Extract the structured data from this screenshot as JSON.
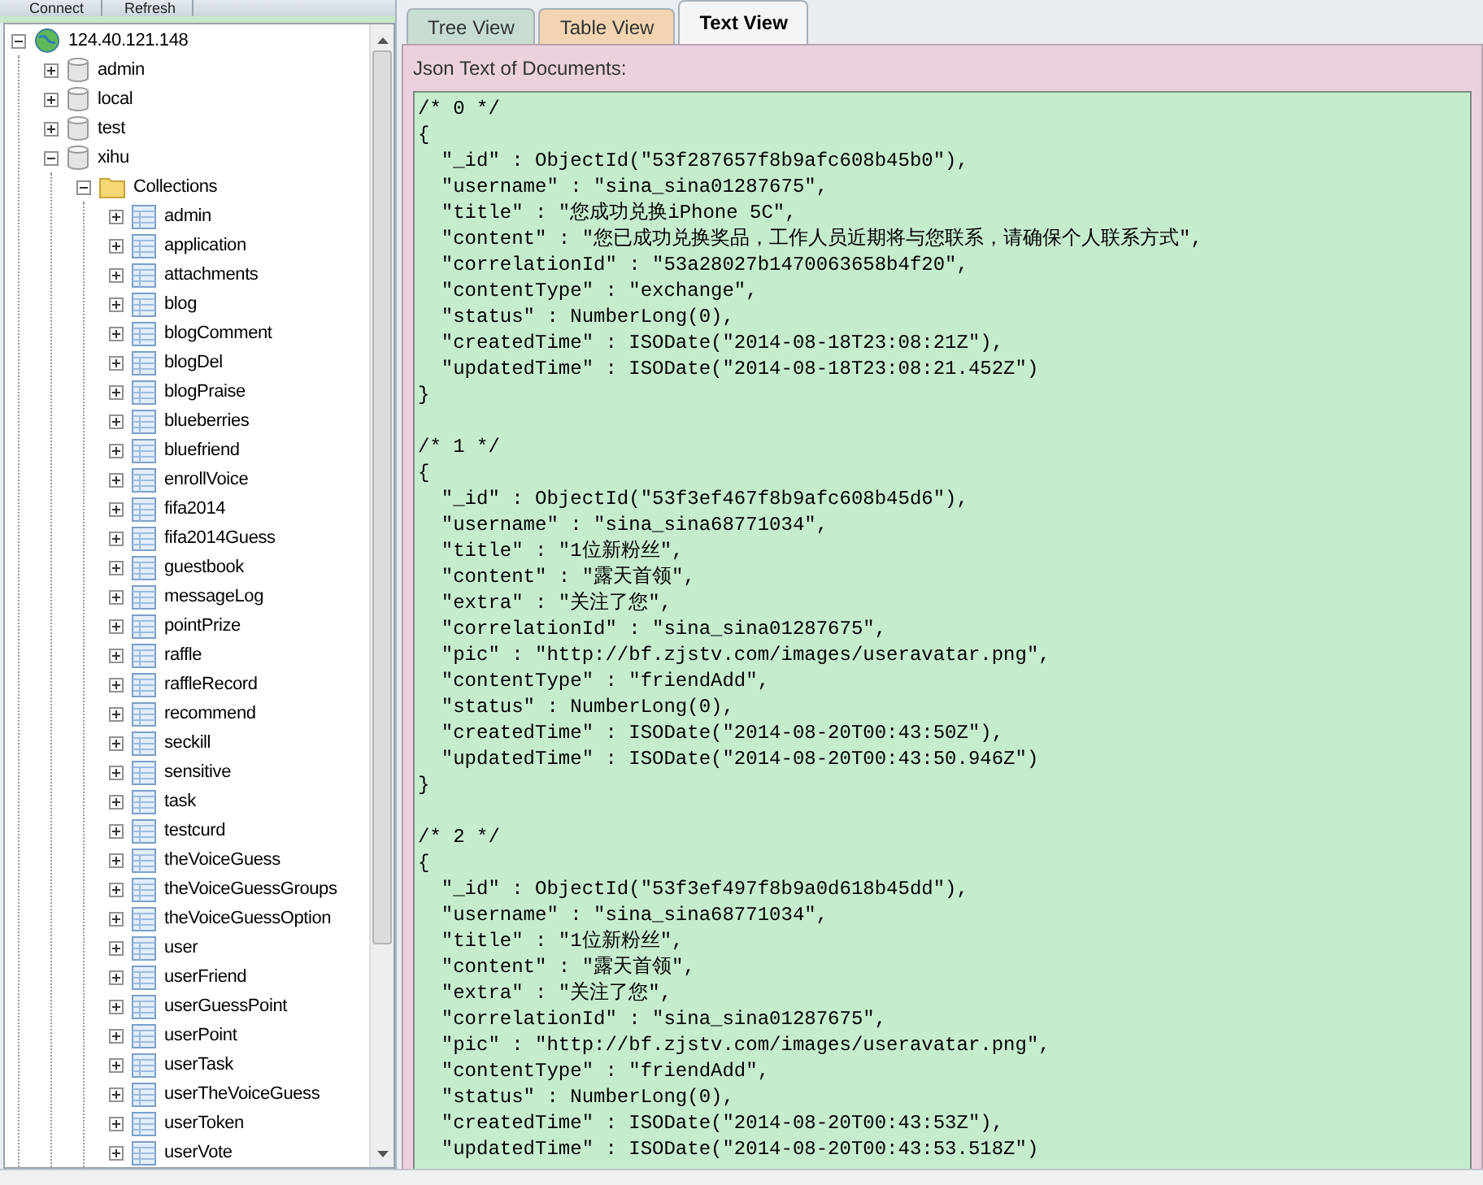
{
  "toolbar": {
    "buttons": [
      "Connect",
      "Refresh"
    ]
  },
  "tree": [
    {
      "label": "124.40.121.148",
      "kind": "server",
      "expanded": true,
      "children": [
        {
          "label": "admin",
          "kind": "database",
          "expanded": false
        },
        {
          "label": "local",
          "kind": "database",
          "expanded": false
        },
        {
          "label": "test",
          "kind": "database",
          "expanded": false
        },
        {
          "label": "xihu",
          "kind": "database",
          "expanded": true,
          "children": [
            {
              "label": "Collections",
              "kind": "folder",
              "expanded": true,
              "children": [
                {
                  "label": "admin",
                  "kind": "collection",
                  "expanded": false
                },
                {
                  "label": "application",
                  "kind": "collection",
                  "expanded": false
                },
                {
                  "label": "attachments",
                  "kind": "collection",
                  "expanded": false
                },
                {
                  "label": "blog",
                  "kind": "collection",
                  "expanded": false
                },
                {
                  "label": "blogComment",
                  "kind": "collection",
                  "expanded": false
                },
                {
                  "label": "blogDel",
                  "kind": "collection",
                  "expanded": false
                },
                {
                  "label": "blogPraise",
                  "kind": "collection",
                  "expanded": false
                },
                {
                  "label": "blueberries",
                  "kind": "collection",
                  "expanded": false
                },
                {
                  "label": "bluefriend",
                  "kind": "collection",
                  "expanded": false
                },
                {
                  "label": "enrollVoice",
                  "kind": "collection",
                  "expanded": false
                },
                {
                  "label": "fifa2014",
                  "kind": "collection",
                  "expanded": false
                },
                {
                  "label": "fifa2014Guess",
                  "kind": "collection",
                  "expanded": false
                },
                {
                  "label": "guestbook",
                  "kind": "collection",
                  "expanded": false
                },
                {
                  "label": "messageLog",
                  "kind": "collection",
                  "expanded": false
                },
                {
                  "label": "pointPrize",
                  "kind": "collection",
                  "expanded": false
                },
                {
                  "label": "raffle",
                  "kind": "collection",
                  "expanded": false
                },
                {
                  "label": "raffleRecord",
                  "kind": "collection",
                  "expanded": false
                },
                {
                  "label": "recommend",
                  "kind": "collection",
                  "expanded": false
                },
                {
                  "label": "seckill",
                  "kind": "collection",
                  "expanded": false
                },
                {
                  "label": "sensitive",
                  "kind": "collection",
                  "expanded": false
                },
                {
                  "label": "task",
                  "kind": "collection",
                  "expanded": false
                },
                {
                  "label": "testcurd",
                  "kind": "collection",
                  "expanded": false
                },
                {
                  "label": "theVoiceGuess",
                  "kind": "collection",
                  "expanded": false
                },
                {
                  "label": "theVoiceGuessGroups",
                  "kind": "collection",
                  "expanded": false
                },
                {
                  "label": "theVoiceGuessOption",
                  "kind": "collection",
                  "expanded": false
                },
                {
                  "label": "user",
                  "kind": "collection",
                  "expanded": false
                },
                {
                  "label": "userFriend",
                  "kind": "collection",
                  "expanded": false
                },
                {
                  "label": "userGuessPoint",
                  "kind": "collection",
                  "expanded": false
                },
                {
                  "label": "userPoint",
                  "kind": "collection",
                  "expanded": false
                },
                {
                  "label": "userTask",
                  "kind": "collection",
                  "expanded": false
                },
                {
                  "label": "userTheVoiceGuess",
                  "kind": "collection",
                  "expanded": false
                },
                {
                  "label": "userToken",
                  "kind": "collection",
                  "expanded": false
                },
                {
                  "label": "userVote",
                  "kind": "collection",
                  "expanded": false
                }
              ]
            }
          ]
        }
      ]
    }
  ],
  "tabs": [
    {
      "label": "Tree View",
      "selected": false,
      "color": "#c8ddd2"
    },
    {
      "label": "Table View",
      "selected": false,
      "color": "#f2d5b0"
    },
    {
      "label": "Text View",
      "selected": true,
      "color": "#f4f4f4"
    }
  ],
  "panel": {
    "label": "Json Text of Documents:"
  },
  "documents": [
    {
      "header": "/* 0 */",
      "open": "{",
      "close": "}",
      "lines": [
        "  \"_id\" : ObjectId(\"53f287657f8b9afc608b45b0\"),",
        "  \"username\" : \"sina_sina01287675\",",
        "  \"title\" : \"您成功兑换iPhone 5C\",",
        "  \"content\" : \"您已成功兑换奖品，工作人员近期将与您联系，请确保个人联系方式\",",
        "  \"correlationId\" : \"53a28027b1470063658b4f20\",",
        "  \"contentType\" : \"exchange\",",
        "  \"status\" : NumberLong(0),",
        "  \"createdTime\" : ISODate(\"2014-08-18T23:08:21Z\"),",
        "  \"updatedTime\" : ISODate(\"2014-08-18T23:08:21.452Z\")"
      ]
    },
    {
      "header": "/* 1 */",
      "open": "{",
      "close": "}",
      "lines": [
        "  \"_id\" : ObjectId(\"53f3ef467f8b9afc608b45d6\"),",
        "  \"username\" : \"sina_sina68771034\",",
        "  \"title\" : \"1位新粉丝\",",
        "  \"content\" : \"露天首领\",",
        "  \"extra\" : \"关注了您\",",
        "  \"correlationId\" : \"sina_sina01287675\",",
        "  \"pic\" : \"http://bf.zjstv.com/images/useravatar.png\",",
        "  \"contentType\" : \"friendAdd\",",
        "  \"status\" : NumberLong(0),",
        "  \"createdTime\" : ISODate(\"2014-08-20T00:43:50Z\"),",
        "  \"updatedTime\" : ISODate(\"2014-08-20T00:43:50.946Z\")"
      ]
    },
    {
      "header": "/* 2 */",
      "open": "{",
      "lines": [
        "  \"_id\" : ObjectId(\"53f3ef497f8b9a0d618b45dd\"),",
        "  \"username\" : \"sina_sina68771034\",",
        "  \"title\" : \"1位新粉丝\",",
        "  \"content\" : \"露天首领\",",
        "  \"extra\" : \"关注了您\",",
        "  \"correlationId\" : \"sina_sina01287675\",",
        "  \"pic\" : \"http://bf.zjstv.com/images/useravatar.png\",",
        "  \"contentType\" : \"friendAdd\",",
        "  \"status\" : NumberLong(0),",
        "  \"createdTime\" : ISODate(\"2014-08-20T00:43:53Z\"),",
        "  \"updatedTime\" : ISODate(\"2014-08-20T00:43:53.518Z\")"
      ]
    }
  ]
}
